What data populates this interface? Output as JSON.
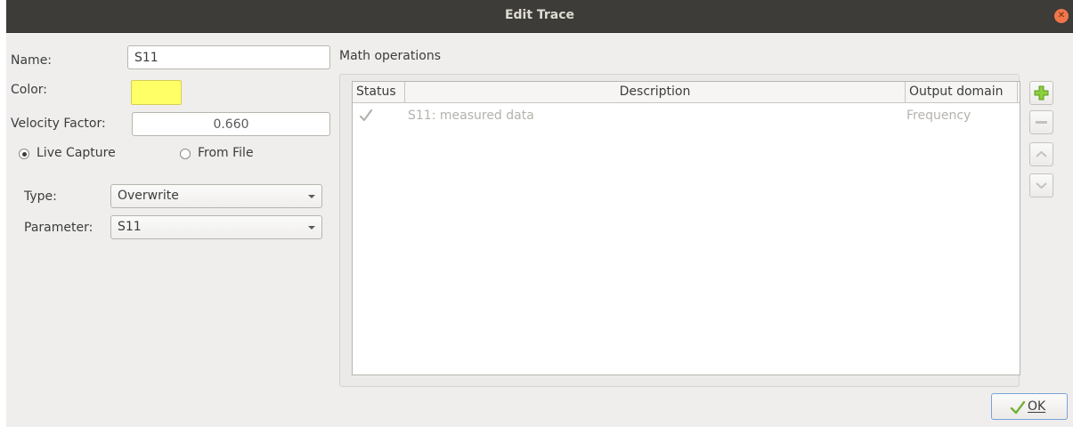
{
  "window": {
    "title": "Edit Trace"
  },
  "form": {
    "name_label": "Name:",
    "name_value": "S11",
    "color_label": "Color:",
    "color_value": "#ffff66",
    "velocity_label": "Velocity Factor:",
    "velocity_value": "0.660",
    "source_options": [
      {
        "label": "Live Capture",
        "checked": true
      },
      {
        "label": "From File",
        "checked": false
      }
    ],
    "type_label": "Type:",
    "type_value": "Overwrite",
    "parameter_label": "Parameter:",
    "parameter_value": "S11"
  },
  "math": {
    "title": "Math operations",
    "columns": [
      "Status",
      "Description",
      "Output domain"
    ],
    "rows": [
      {
        "status_icon": "check-icon",
        "description": "S11: measured data",
        "output_domain": "Frequency"
      }
    ],
    "buttons": [
      "add-icon",
      "remove-icon",
      "move-up-icon",
      "move-down-icon"
    ]
  },
  "footer": {
    "ok_label": "OK",
    "ok_mnemonic": "O"
  }
}
